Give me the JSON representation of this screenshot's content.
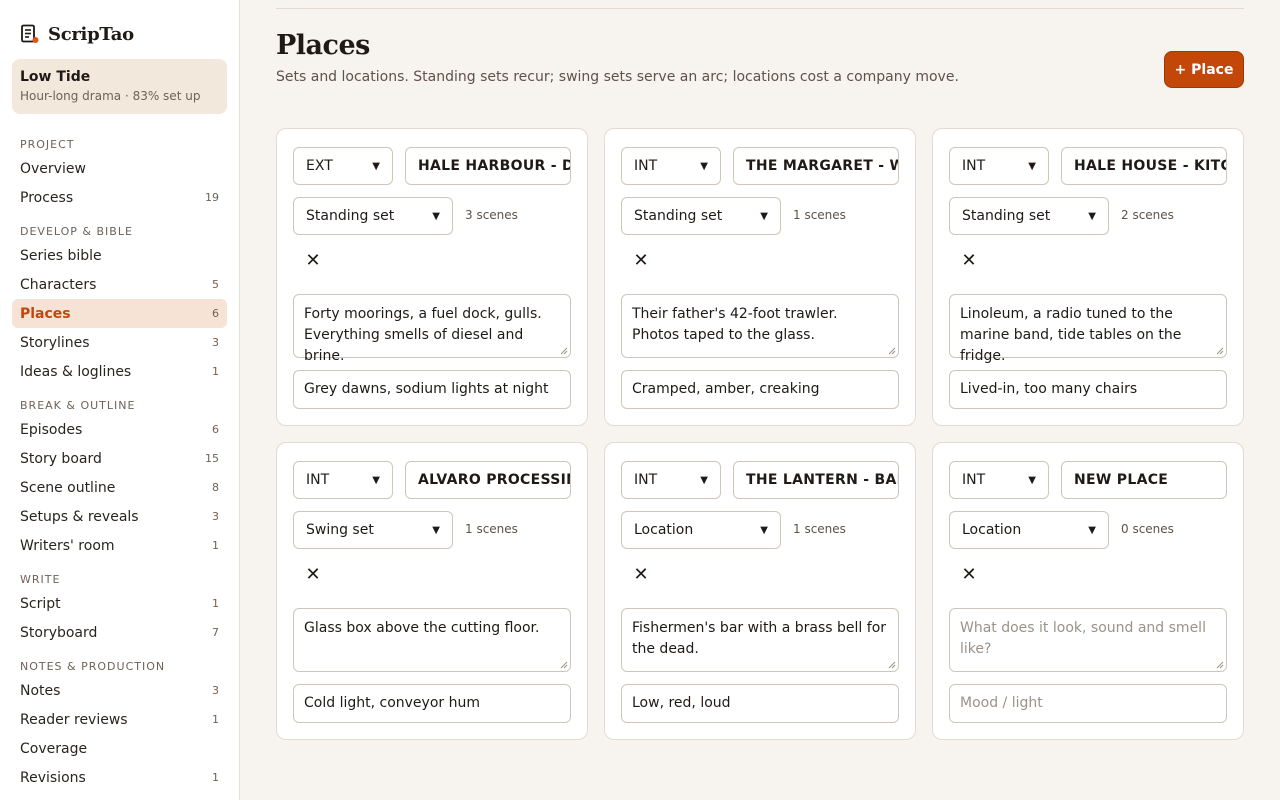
{
  "app": {
    "name": "ScripTao"
  },
  "project": {
    "name": "Low Tide",
    "subtitle": "Hour-long drama · 83% set up"
  },
  "nav": [
    {
      "section": "PROJECT",
      "items": [
        {
          "label": "Overview",
          "count": ""
        },
        {
          "label": "Process",
          "count": "19"
        }
      ]
    },
    {
      "section": "DEVELOP & BIBLE",
      "items": [
        {
          "label": "Series bible",
          "count": ""
        },
        {
          "label": "Characters",
          "count": "5"
        },
        {
          "label": "Places",
          "count": "6",
          "active": true
        },
        {
          "label": "Storylines",
          "count": "3"
        },
        {
          "label": "Ideas & loglines",
          "count": "1"
        }
      ]
    },
    {
      "section": "BREAK & OUTLINE",
      "items": [
        {
          "label": "Episodes",
          "count": "6"
        },
        {
          "label": "Story board",
          "count": "15"
        },
        {
          "label": "Scene outline",
          "count": "8"
        },
        {
          "label": "Setups & reveals",
          "count": "3"
        },
        {
          "label": "Writers' room",
          "count": "1"
        }
      ]
    },
    {
      "section": "WRITE",
      "items": [
        {
          "label": "Script",
          "count": "1"
        },
        {
          "label": "Storyboard",
          "count": "7"
        }
      ]
    },
    {
      "section": "NOTES & PRODUCTION",
      "items": [
        {
          "label": "Notes",
          "count": "3"
        },
        {
          "label": "Reader reviews",
          "count": "1"
        },
        {
          "label": "Coverage",
          "count": ""
        },
        {
          "label": "Revisions",
          "count": "1"
        }
      ]
    }
  ],
  "page": {
    "title": "Places",
    "subtitle": "Sets and locations. Standing sets recur; swing sets serve an arc; locations cost a company move.",
    "add_label": "+ Place"
  },
  "places": [
    {
      "int_ext": "EXT",
      "name": "HALE HARBOUR - DO",
      "set_type": "Standing set",
      "scenes": "3 scenes",
      "description": "Forty moorings, a fuel dock, gulls. Everything smells of diesel and brine.",
      "mood": "Grey dawns, sodium lights at night"
    },
    {
      "int_ext": "INT",
      "name": "THE MARGARET - WH",
      "set_type": "Standing set",
      "scenes": "1 scenes",
      "description": "Their father's 42-foot trawler. Photos taped to the glass.",
      "mood": "Cramped, amber, creaking"
    },
    {
      "int_ext": "INT",
      "name": "HALE HOUSE - KITCH",
      "set_type": "Standing set",
      "scenes": "2 scenes",
      "description": "Linoleum, a radio tuned to the marine band, tide tables on the fridge.",
      "mood": "Lived-in, too many chairs"
    },
    {
      "int_ext": "INT",
      "name": "ALVARO PROCESSING",
      "set_type": "Swing set",
      "scenes": "1 scenes",
      "description": "Glass box above the cutting floor.",
      "mood": "Cold light, conveyor hum"
    },
    {
      "int_ext": "INT",
      "name": "THE LANTERN - BAR",
      "set_type": "Location",
      "scenes": "1 scenes",
      "description": "Fishermen's bar with a brass bell for the dead.",
      "mood": "Low, red, loud"
    },
    {
      "int_ext": "INT",
      "name": "NEW PLACE",
      "set_type": "Location",
      "scenes": "0 scenes",
      "description": "",
      "mood": "",
      "description_placeholder": "What does it look, sound and smell like?",
      "mood_placeholder": "Mood / light"
    }
  ],
  "colors": {
    "accent": "#c4470a",
    "active_bg": "#f6e3d6",
    "page_bg": "#f7f3ee"
  }
}
